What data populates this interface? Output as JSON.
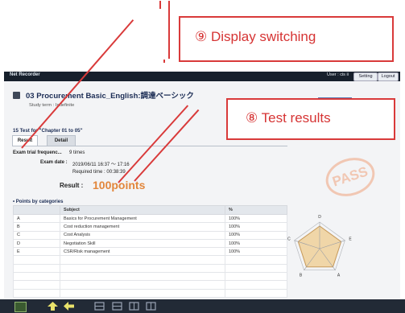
{
  "window": {
    "app_title": "Net Recorder",
    "user_label": "User : cis ii",
    "setting_label": "Setting",
    "logout_label": "Logout"
  },
  "course": {
    "title": "03 Procurement Basic_English:調達ベーシック",
    "study_term": "Study term : Indefinite"
  },
  "test": {
    "title": "15 Test for \"Chapter 01 to 05\"",
    "tabs": [
      {
        "label": "Result"
      },
      {
        "label": "Detail"
      }
    ],
    "trial_frequency_label": "Exam trial frequenc...",
    "trial_frequency_value": "9 times",
    "exam_date_label": "Exam date :",
    "exam_date_value": "2019/06/11 16:37 ～ 17:16",
    "required_time": "Required time : 00:38:39",
    "result_label": "Result :",
    "result_value": "100points",
    "pass_stamp": "PASS"
  },
  "categories": {
    "heading": "• Points by categories",
    "columns": [
      "",
      "Subject",
      "%"
    ],
    "rows": [
      {
        "id": "A",
        "subject": "Basics for Procurement Management",
        "pct": "100%"
      },
      {
        "id": "B",
        "subject": "Cost reduction management",
        "pct": "100%"
      },
      {
        "id": "C",
        "subject": "Cost Analysis",
        "pct": "100%"
      },
      {
        "id": "D",
        "subject": "Negotiation Skill",
        "pct": "100%"
      },
      {
        "id": "E",
        "subject": "CSR/Risk management",
        "pct": "100%"
      }
    ]
  },
  "radar": {
    "axis_labels": [
      "D",
      "E",
      "A",
      "B",
      "C"
    ],
    "values": [
      1,
      1,
      1,
      1,
      1
    ]
  },
  "annotations": {
    "display_switching": "⑨ Display switching",
    "test_results": "⑧ Test results"
  },
  "colors": {
    "accent_red": "#d93a3a",
    "result_orange": "#e2863b",
    "title_navy": "#1c2d55"
  },
  "toolbar": {
    "icons": [
      "tile-icon",
      "up-arrow-icon",
      "back-arrow-icon",
      "grid-icon",
      "grid-icon",
      "grid-icon",
      "grid-icon"
    ]
  }
}
